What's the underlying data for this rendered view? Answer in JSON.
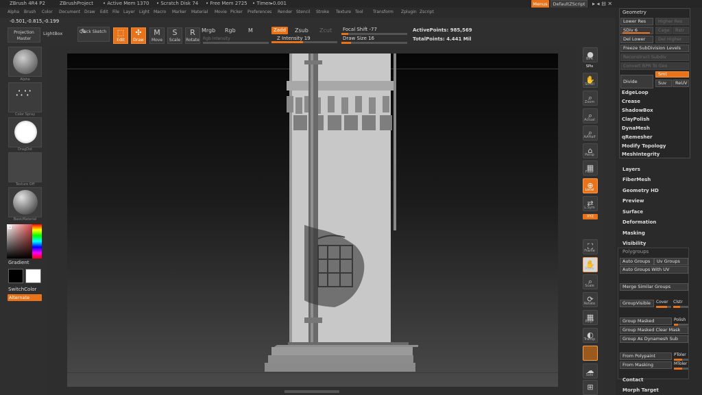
{
  "titlebar": {
    "app": "ZBrush 4R4 P2",
    "project": "ZBrushProject",
    "active_mem": "• Active Mem 1370",
    "scratch": "• Scratch Disk 74",
    "free_mem": "• Free Mem 2725",
    "timer": "• Timer▸0.001",
    "menus_button": "Menus",
    "script_button": "DefaultZScript"
  },
  "menubar": [
    "Alpha",
    "Brush",
    "Color",
    "Document",
    "Draw",
    "Edit",
    "File",
    "Layer",
    "Light",
    "Macro",
    "Marker",
    "Material",
    "Movie",
    "Picker",
    "Preferences",
    "Render",
    "Stencil",
    "Stroke",
    "Texture",
    "Tool",
    "Transform",
    "Zplugin",
    "Zscript"
  ],
  "coords": "-0.501,-0.815,-0.199",
  "toolbar": {
    "projection_master": "Projection Master",
    "lightbox": "LightBox",
    "quick_sketch": "Quick Sketch",
    "edit": "Edit",
    "draw": "Draw",
    "move": "Move",
    "scale": "Scale",
    "rotate": "Rotate",
    "mrgb": "Mrgb",
    "rgb": "Rgb",
    "m": "M",
    "rgb_intensity": "Rgb Intensity",
    "zadd": "Zadd",
    "zsub": "Zsub",
    "zcut": "Zcut",
    "z_intensity": "Z Intensity 19",
    "focal_shift": "Focal Shift -77",
    "draw_size": "Draw Size 16",
    "active_points": "ActivePoints: 985,569",
    "total_points": "TotalPoints: 4.441  Mil"
  },
  "leftshelf": {
    "captions": [
      "Alpha",
      "Color Spray",
      "DragDot",
      "Texture Off",
      "BasicMaterial"
    ],
    "gradient": "Gradient",
    "switch_color": "SwitchColor",
    "alternate": "Alternate"
  },
  "rightshelf": [
    "BPR",
    "SPix",
    "Scroll",
    "Zoom",
    "Actual",
    "AAHalf",
    "Persp",
    "Floor",
    "Local",
    "L.Sym",
    "XYZ",
    "Frame",
    "Move",
    "Scale",
    "Rotate",
    "PolyF",
    "Transp",
    "Ghost",
    "Solo",
    "Xpose"
  ],
  "geometry": {
    "title": "Geometry",
    "lower_res": "Lower Res",
    "higher_res": "Higher Res",
    "sdiv": "SDiv 6",
    "cage": "Cage",
    "rstr": "Rstr",
    "del_lower": "Del Lower",
    "del_higher": "Del Higher",
    "freeze": "Freeze SubDivision Levels",
    "reconstruct": "Reconstruct Subdiv",
    "convert_bpr": "Convert BPR To Geo",
    "divide": "Divide",
    "smt": "Smt",
    "suv": "Suv",
    "reuv": "ReUV",
    "items": [
      "EdgeLoop",
      "Crease",
      "ShadowBox",
      "ClayPolish",
      "DynaMesh",
      "qRemesher",
      "Modify Topology",
      "MeshIntegrity"
    ]
  },
  "subtool_sections": [
    "Layers",
    "FiberMesh",
    "Geometry HD",
    "Preview",
    "Surface",
    "Deformation",
    "Masking",
    "Visibility"
  ],
  "polygroups": {
    "title": "Polygroups",
    "auto_groups": "Auto Groups",
    "uv_groups": "Uv Groups",
    "auto_groups_uv": "Auto Groups With UV",
    "merge_similar": "Merge Similar Groups",
    "group_visible": "GroupVisible",
    "coverage": "Cover",
    "clustering": "Clstr",
    "group_masked": "Group Masked",
    "polish": "Polish",
    "group_masked_clear": "Group Masked Clear Mask",
    "group_dynamesh": "Group As Dynamesh Sub",
    "from_polypaint": "From Polypaint",
    "ptolerance": "PToler",
    "from_masking": "From Masking",
    "mtolerance": "MToler"
  },
  "bottom_sections": [
    "Contact",
    "Morph Target"
  ],
  "colors": {
    "accent": "#e8731a",
    "panel": "#2a2a2a",
    "viewport_top": "#060606"
  }
}
